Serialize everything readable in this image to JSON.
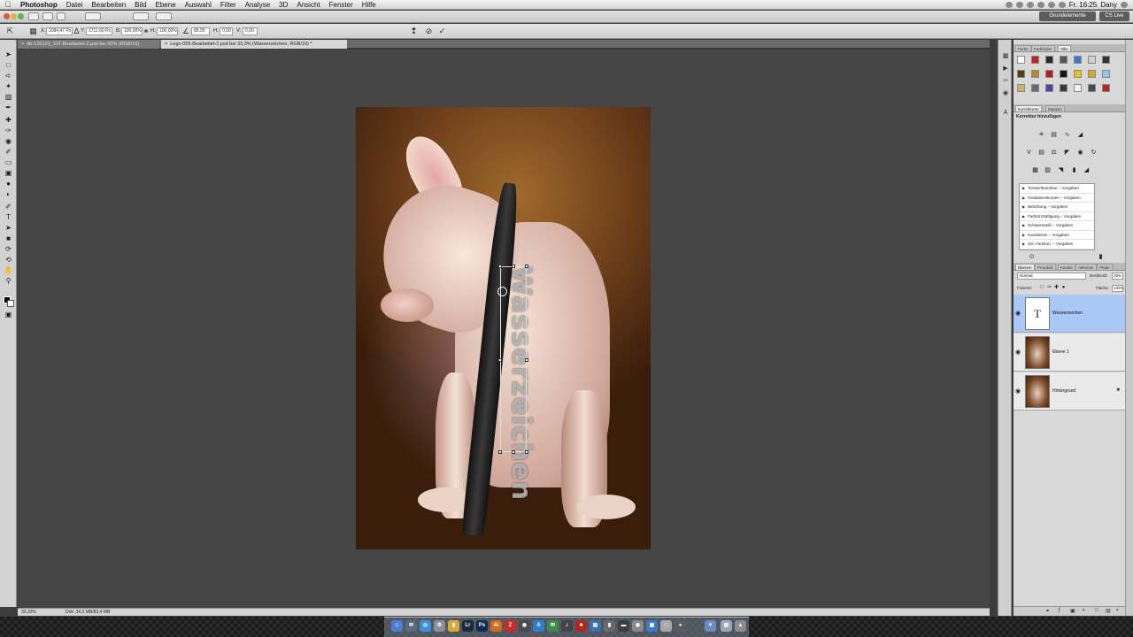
{
  "menubar": {
    "apple_icon": "apple-icon",
    "app_name": "Photoshop",
    "items": [
      "Datei",
      "Bearbeiten",
      "Bild",
      "Ebene",
      "Auswahl",
      "Filter",
      "Analyse",
      "3D",
      "Ansicht",
      "Fenster",
      "Hilfe"
    ],
    "clock": "Fr. 16:25",
    "user": "Dany"
  },
  "appbar": {
    "workspace": "Grundelemente",
    "cs_live": "CS Live"
  },
  "options": {
    "x_label": "X:",
    "x_value": "1084,47 Px",
    "y_label": "Y:",
    "y_value": "1711,60 Px",
    "w_label": "B:",
    "w_value": "100,00%",
    "h_label": "H:",
    "h_value": "100,00%",
    "angle_value": "89,95",
    "hskew_label": "H:",
    "hskew_value": "0,00",
    "vskew_label": "V:",
    "vskew_value": "0,00"
  },
  "tabs": [
    {
      "label": "db-120120_107-Bearbeitet-2.psd bei 50% (RGB/16)"
    },
    {
      "label": "Lego-055-Bearbeitet-2.psd bei 33,3% (Wasserzeichen, RGB/16) *"
    }
  ],
  "document": {
    "watermark_text": "Wasserzeichen"
  },
  "status": {
    "zoom": "33,33%",
    "doc_size": "Dok: 34,3 MB/83,4 MB"
  },
  "panels": {
    "styles_tabs": [
      "Farbe",
      "Farbfelder",
      "Stile"
    ],
    "adjust_tabs": [
      "Korrekturen",
      "Masken"
    ],
    "adjust_title": "Korrektur hinzufügen",
    "presets": [
      "Tonwertkorrektur – Vorgaben",
      "Gradationskurven – Vorgaben",
      "Belichtung – Vorgaben",
      "Farbton/Sättigung – Vorgaben",
      "Schwarzweiß – Vorgaben",
      "Kanalmixer – Vorgaben",
      "Sel. Farbkorr. – Vorgaben"
    ],
    "layers_tabs": [
      "Ebenen",
      "Protokoll",
      "Kanäle",
      "Aktionen",
      "Pfade"
    ],
    "blend_mode": "Normal",
    "opacity_label": "Deckkraft:",
    "opacity_value": "29%",
    "lock_label": "Fixieren:",
    "fill_label": "Fläche:",
    "fill_value": "100%",
    "layers": [
      {
        "name": "Wasserzeichen",
        "thumb": "T"
      },
      {
        "name": "Ebene 1"
      },
      {
        "name": "Hintergrund"
      }
    ]
  },
  "colors": {
    "selected_layer": "#a9c8f5",
    "canvas_bg": "#454545"
  }
}
